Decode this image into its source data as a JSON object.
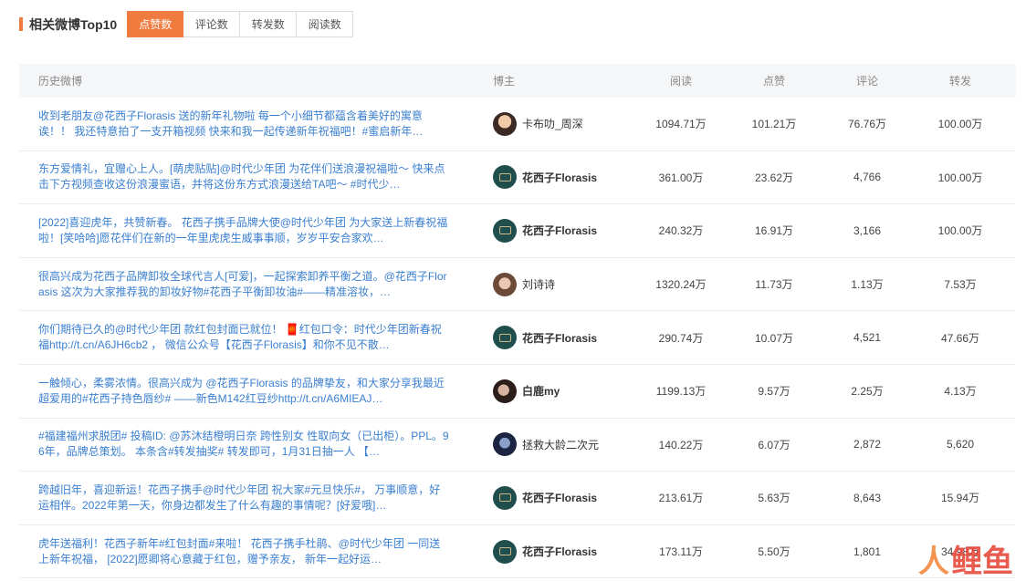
{
  "header": {
    "title": "相关微博Top10",
    "tabs": [
      {
        "label": "点赞数",
        "active": true
      },
      {
        "label": "评论数",
        "active": false
      },
      {
        "label": "转发数",
        "active": false
      },
      {
        "label": "阅读数",
        "active": false
      }
    ]
  },
  "table": {
    "columns": {
      "post": "历史微博",
      "author": "博主",
      "reads": "阅读",
      "likes": "点赞",
      "comments": "评论",
      "reposts": "转发"
    },
    "rows": [
      {
        "post": "收到老朋友@花西子Florasis 送的新年礼物啦 每一个小细节都蕴含着美好的寓意诶！！ 我还特意拍了一支开箱视频 快来和我一起传递新年祝福吧！#蜜启新年…",
        "author": "卡布叻_周深",
        "avatar": "person-avatar-1",
        "reads": "1094.71万",
        "likes": "101.21万",
        "comments": "76.76万",
        "reposts": "100.00万"
      },
      {
        "post": "东方爱情礼，宜赠心上人。[萌虎贴贴]@时代少年团 为花伴们送浪漫祝福啦～ 快来点击下方视频查收这份浪漫蜜语，并将这份东方式浪漫送给TA吧～ #时代少…",
        "author": "花西子Florasis",
        "avatar": "brand-avatar",
        "reads": "361.00万",
        "likes": "23.62万",
        "comments": "4,766",
        "reposts": "100.00万"
      },
      {
        "post": "[2022]喜迎虎年，共赞新春。 花西子携手品牌大使@时代少年团 为大家送上新春祝福啦！[笑哈哈]愿花伴们在新的一年里虎虎生威事事顺，岁岁平安合家欢…",
        "author": "花西子Florasis",
        "avatar": "brand-avatar",
        "reads": "240.32万",
        "likes": "16.91万",
        "comments": "3,166",
        "reposts": "100.00万"
      },
      {
        "post": "很高兴成为花西子品牌卸妆全球代言人[可爱]，一起探索卸养平衡之道。@花西子Florasis 这次为大家推荐我的卸妆好物#花西子平衡卸妆油#——精准溶妆，…",
        "author": "刘诗诗",
        "avatar": "person-avatar-2",
        "reads": "1320.24万",
        "likes": "11.73万",
        "comments": "1.13万",
        "reposts": "7.53万"
      },
      {
        "post": "你们期待已久的@时代少年团 款红包封面已就位！ 🧧红包口令：时代少年团新春祝福http://t.cn/A6JH6cb2 ， 微信公众号【花西子Florasis】和你不见不散…",
        "author": "花西子Florasis",
        "avatar": "brand-avatar",
        "reads": "290.74万",
        "likes": "10.07万",
        "comments": "4,521",
        "reposts": "47.66万"
      },
      {
        "post": "一触倾心，柔雾浓情。很高兴成为 @花西子Florasis 的品牌挚友，和大家分享我最近超爱用的#花西子持色唇纱# ——新色M142红豆纱http://t.cn/A6MIEAJ…",
        "author": "白鹿my",
        "avatar": "person-avatar-3",
        "reads": "1199.13万",
        "likes": "9.57万",
        "comments": "2.25万",
        "reposts": "4.13万"
      },
      {
        "post": "#福建福州求脱团# 投稿ID: @苏沐结橙明日奈 跨性别女 性取向女（已出柜）。PPL。96年，品牌总策划。 本条含#转发抽奖# 转发即可，1月31日抽一人 【…",
        "author": "拯救大龄二次元",
        "avatar": "person-avatar-4",
        "reads": "140.22万",
        "likes": "6.07万",
        "comments": "2,872",
        "reposts": "5,620"
      },
      {
        "post": "跨越旧年，喜迎新运！花西子携手@时代少年团 祝大家#元旦快乐#， 万事顺意，好运相伴。2022年第一天，你身边都发生了什么有趣的事情呢？[好爱哦]…",
        "author": "花西子Florasis",
        "avatar": "brand-avatar",
        "reads": "213.61万",
        "likes": "5.63万",
        "comments": "8,643",
        "reposts": "15.94万"
      },
      {
        "post": "虎年送福利！花西子新年#红包封面#来啦！ 花西子携手杜鹃、@时代少年团 一同送上新年祝福， [2022]愿卿将心意藏于红包，赠予亲友， 新年一起好运…",
        "author": "花西子Florasis",
        "avatar": "brand-avatar",
        "reads": "173.11万",
        "likes": "5.50万",
        "comments": "1,801",
        "reposts": "34.98万"
      }
    ]
  },
  "watermark": {
    "text_accent": "人",
    "text_rest": "鲤鱼"
  }
}
